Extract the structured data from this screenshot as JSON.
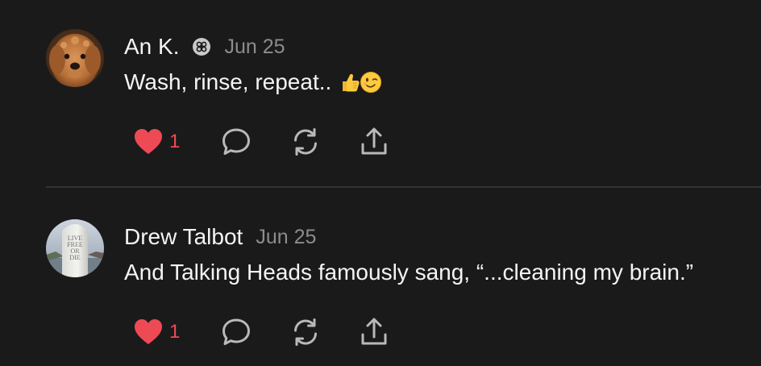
{
  "posts": [
    {
      "author": "An K.",
      "verified_icon": "community-badge-icon",
      "date": "Jun 25",
      "text": "Wash, rinse, repeat..",
      "emojis": [
        "thumbs-up-emoji",
        "winking-face-emoji"
      ],
      "likes": "1",
      "liked": true,
      "avatar": "golden-doodle-dog-photo"
    },
    {
      "author": "Drew Talbot",
      "date": "Jun 25",
      "text": "And Talking Heads famously sang, “...cleaning my brain.”",
      "likes": "1",
      "liked": true,
      "avatar": "live-free-or-die-monument-photo",
      "avatar_text": "LIVE FREE OR DIE"
    }
  ],
  "icons": {
    "like": "heart-icon",
    "reply": "speech-bubble-icon",
    "repost": "repost-arrows-icon",
    "share": "share-icon"
  },
  "colors": {
    "background": "#1a1a1b",
    "text": "#f4f4f4",
    "muted": "#8c8c8e",
    "like": "#ee4a56",
    "icon": "#b9b9bb",
    "divider": "#333335"
  }
}
